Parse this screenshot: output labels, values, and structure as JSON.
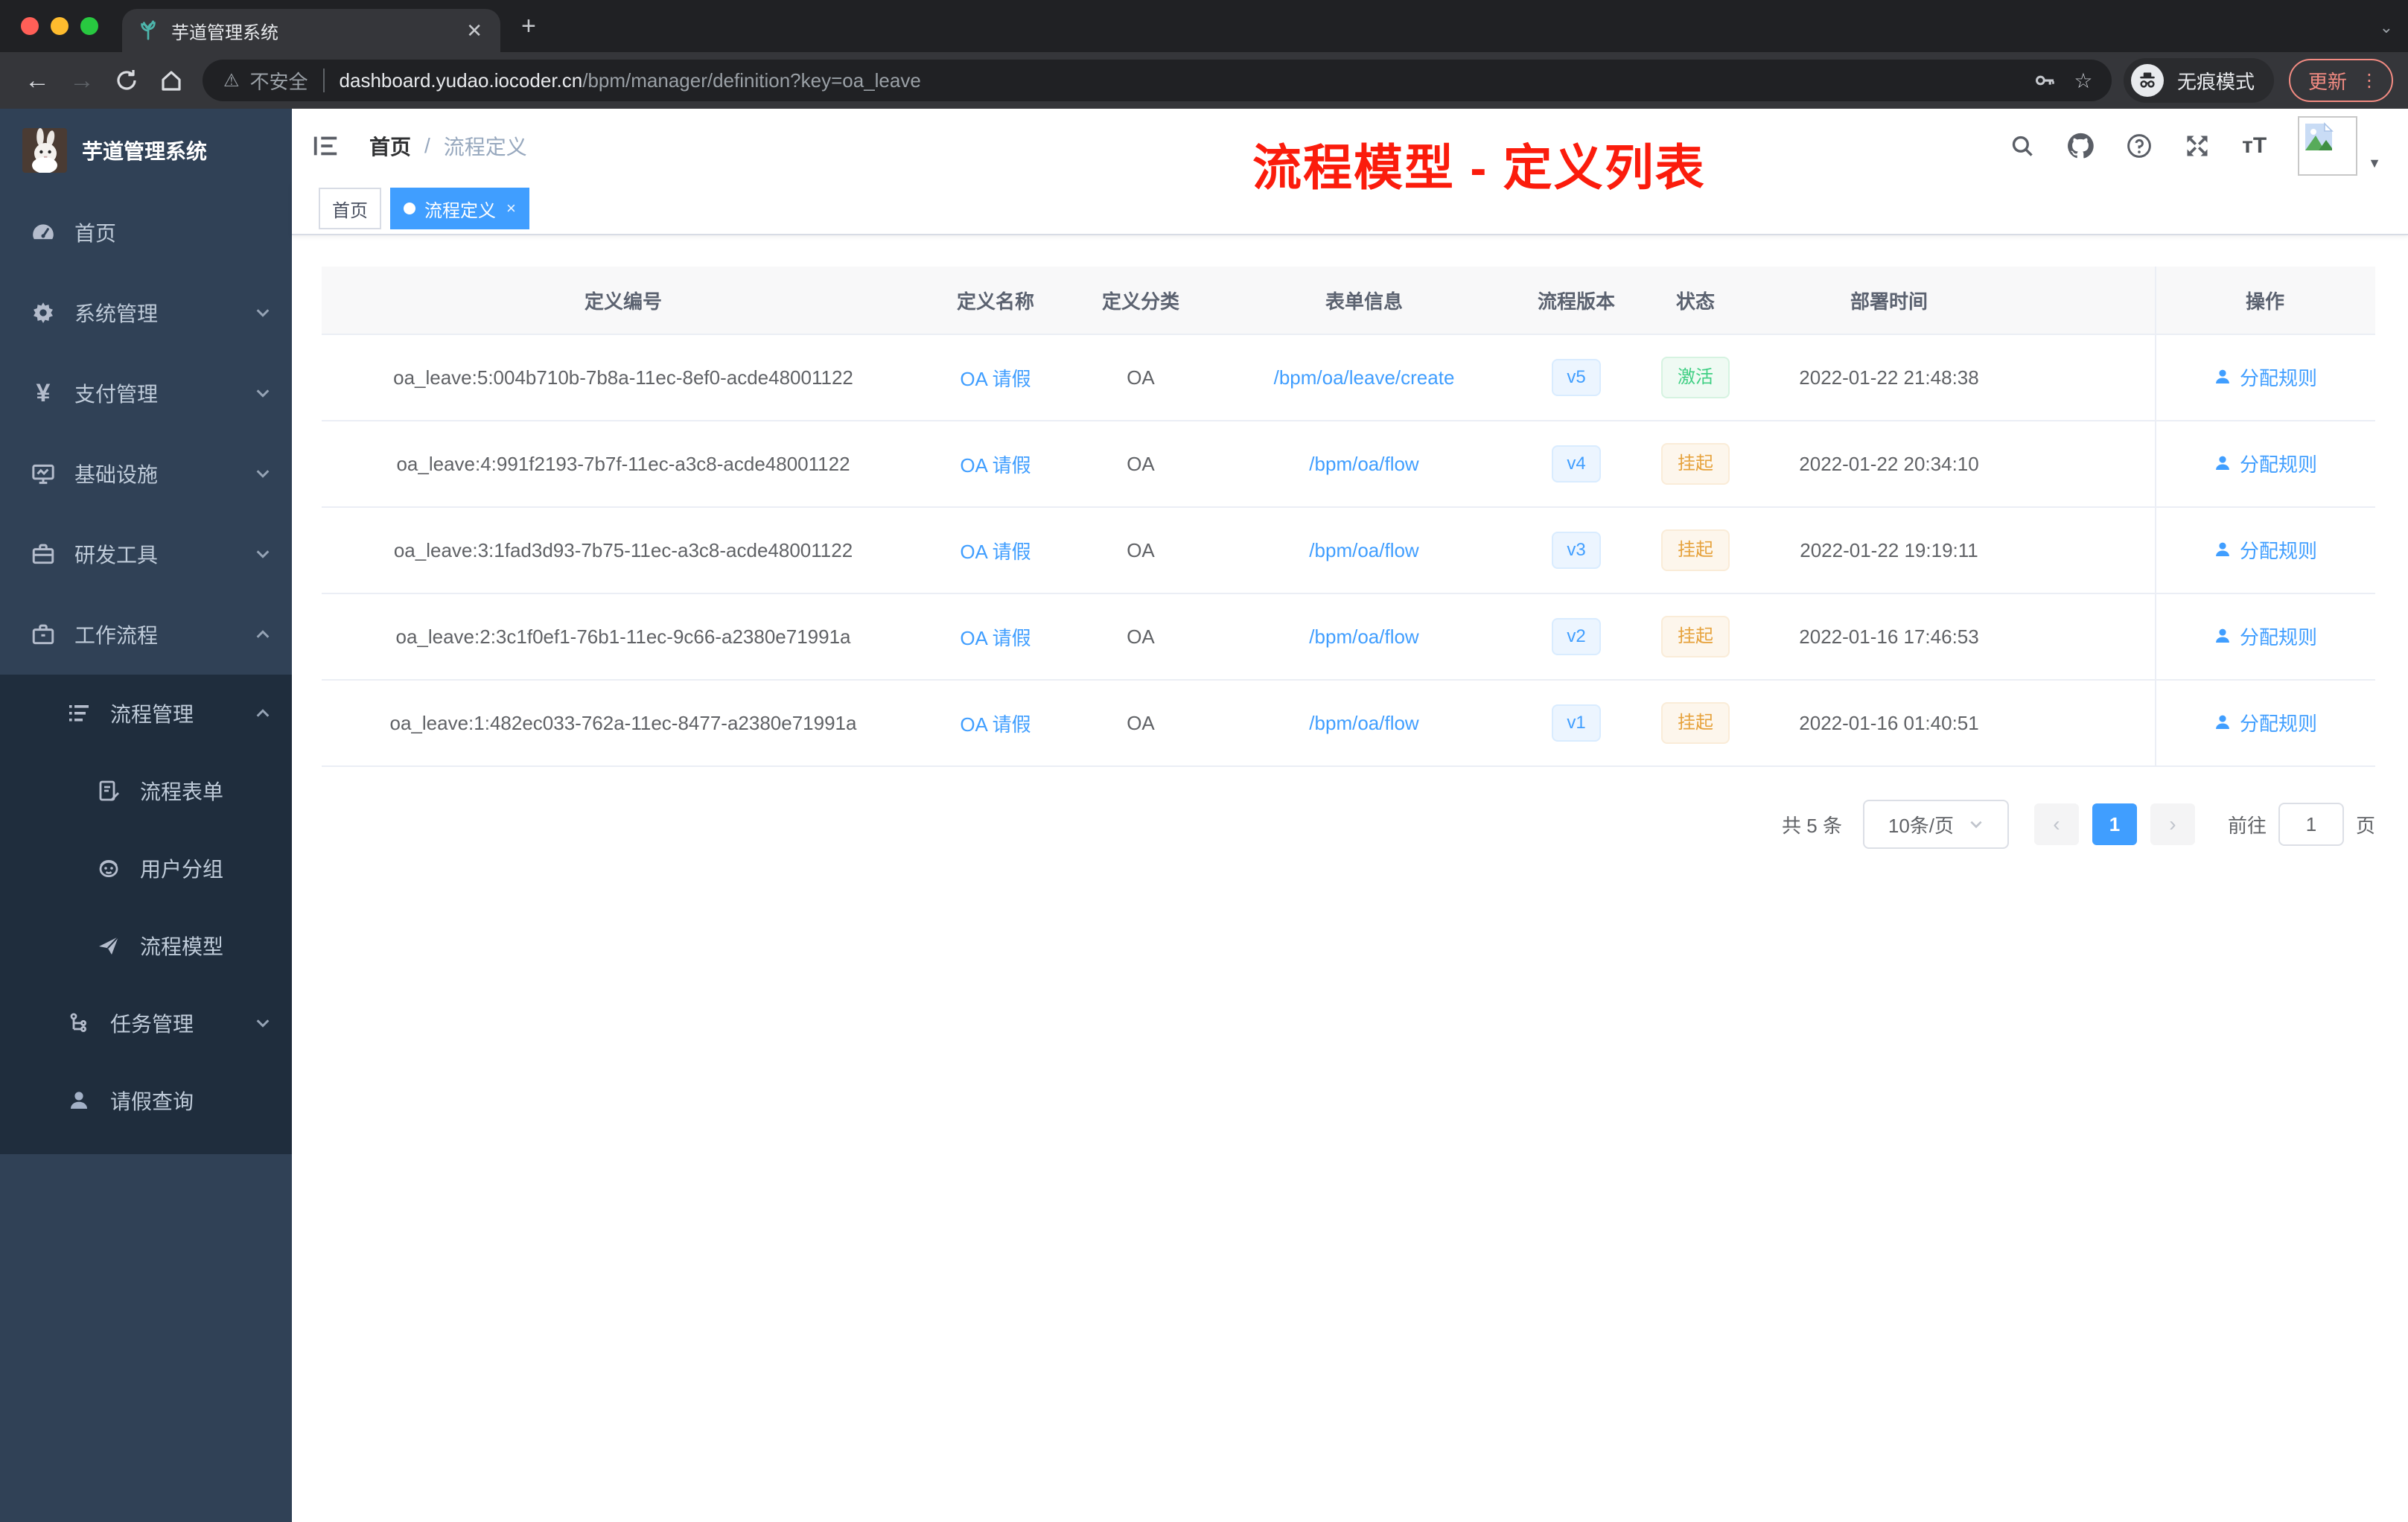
{
  "browser": {
    "tab_title": "芋道管理系统",
    "new_tab": "+",
    "close_tab": "✕",
    "security_label": "不安全",
    "url_host": "dashboard.yudao.iocoder.cn",
    "url_path": "/bpm/manager/definition?key=oa_leave",
    "incognito_label": "无痕模式",
    "update_label": "更新"
  },
  "sidebar": {
    "logo_title": "芋道管理系统",
    "items": [
      {
        "label": "首页",
        "icon": "dashboard-icon"
      },
      {
        "label": "系统管理",
        "icon": "gear-icon",
        "state": "collapsed"
      },
      {
        "label": "支付管理",
        "icon": "yen-icon",
        "state": "collapsed"
      },
      {
        "label": "基础设施",
        "icon": "monitor-icon",
        "state": "collapsed"
      },
      {
        "label": "研发工具",
        "icon": "toolbox-icon",
        "state": "collapsed"
      },
      {
        "label": "工作流程",
        "icon": "briefcase-icon",
        "state": "expanded"
      }
    ],
    "submenu": [
      {
        "label": "流程管理",
        "icon": "list-icon",
        "state": "expanded"
      },
      {
        "label": "流程表单",
        "icon": "form-icon"
      },
      {
        "label": "用户分组",
        "icon": "user-group-icon"
      },
      {
        "label": "流程模型",
        "icon": "send-icon"
      },
      {
        "label": "任务管理",
        "icon": "tree-icon",
        "state": "collapsed"
      },
      {
        "label": "请假查询",
        "icon": "user-icon"
      }
    ]
  },
  "navbar": {
    "breadcrumb_home": "首页",
    "breadcrumb_sep": "/",
    "breadcrumb_current": "流程定义",
    "annotation": "流程模型 - 定义列表",
    "annotation_color": "#fb1c0c"
  },
  "tags": {
    "home": "首页",
    "active_tag": "流程定义",
    "close": "×"
  },
  "table": {
    "headers": [
      "定义编号",
      "定义名称",
      "定义分类",
      "表单信息",
      "流程版本",
      "状态",
      "部署时间",
      "操作"
    ],
    "action_label": "分配规则",
    "rows": [
      {
        "id": "oa_leave:5:004b710b-7b8a-11ec-8ef0-acde48001122",
        "name": "OA 请假",
        "category": "OA",
        "form": "/bpm/oa/leave/create",
        "version": "v5",
        "status": "激活",
        "status_type": "active",
        "time": "2022-01-22 21:48:38"
      },
      {
        "id": "oa_leave:4:991f2193-7b7f-11ec-a3c8-acde48001122",
        "name": "OA 请假",
        "category": "OA",
        "form": "/bpm/oa/flow",
        "version": "v4",
        "status": "挂起",
        "status_type": "suspend",
        "time": "2022-01-22 20:34:10"
      },
      {
        "id": "oa_leave:3:1fad3d93-7b75-11ec-a3c8-acde48001122",
        "name": "OA 请假",
        "category": "OA",
        "form": "/bpm/oa/flow",
        "version": "v3",
        "status": "挂起",
        "status_type": "suspend",
        "time": "2022-01-22 19:19:11"
      },
      {
        "id": "oa_leave:2:3c1f0ef1-76b1-11ec-9c66-a2380e71991a",
        "name": "OA 请假",
        "category": "OA",
        "form": "/bpm/oa/flow",
        "version": "v2",
        "status": "挂起",
        "status_type": "suspend",
        "time": "2022-01-16 17:46:53"
      },
      {
        "id": "oa_leave:1:482ec033-762a-11ec-8477-a2380e71991a",
        "name": "OA 请假",
        "category": "OA",
        "form": "/bpm/oa/flow",
        "version": "v1",
        "status": "挂起",
        "status_type": "suspend",
        "time": "2022-01-16 01:40:51"
      }
    ]
  },
  "pagination": {
    "total_text": "共 5 条",
    "page_size": "10条/页",
    "prev": "‹",
    "next": "›",
    "current_page": "1",
    "goto_label": "前往",
    "goto_value": "1",
    "page_label": "页"
  },
  "colors": {
    "accent": "#409eff",
    "status_active": "#3fcf83",
    "status_suspend": "#e6a23c",
    "sidebar_bg": "#304156",
    "submenu_bg": "#1f2d3d"
  }
}
